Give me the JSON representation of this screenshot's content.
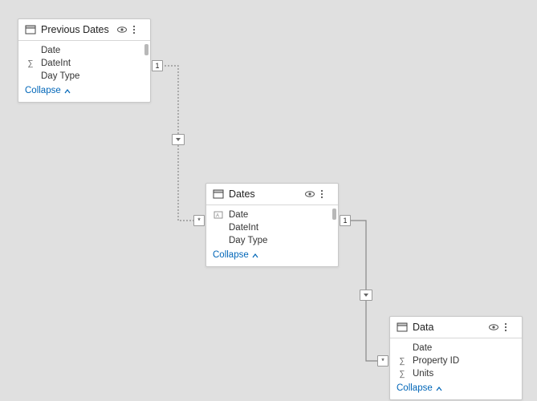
{
  "tables": {
    "previousDates": {
      "title": "Previous Dates",
      "fields": [
        {
          "icon": "",
          "label": "Date"
        },
        {
          "icon": "sigma",
          "label": "DateInt"
        },
        {
          "icon": "",
          "label": "Day Type"
        }
      ],
      "collapse": "Collapse"
    },
    "dates": {
      "title": "Dates",
      "fields": [
        {
          "icon": "text",
          "label": "Date"
        },
        {
          "icon": "",
          "label": "DateInt"
        },
        {
          "icon": "",
          "label": "Day Type"
        }
      ],
      "collapse": "Collapse"
    },
    "data": {
      "title": "Data",
      "fields": [
        {
          "icon": "",
          "label": "Date"
        },
        {
          "icon": "sigma",
          "label": "Property ID"
        },
        {
          "icon": "sigma",
          "label": "Units"
        }
      ],
      "collapse": "Collapse"
    }
  },
  "rel": {
    "one": "1",
    "many": "*"
  }
}
